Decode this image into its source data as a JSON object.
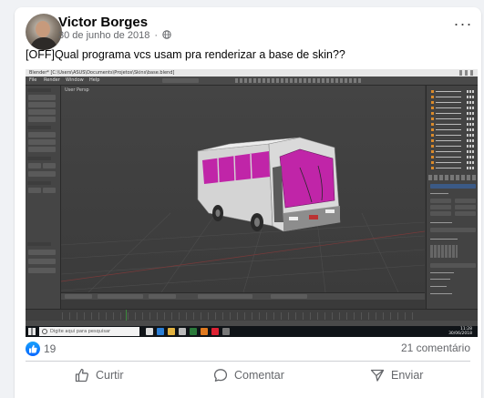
{
  "post": {
    "author": "Victor Borges",
    "date": "30 de junho de 2018",
    "separator": "·",
    "text": "[OFF]Qual programa vcs usam pra renderizar a base de skin??",
    "more_label": "···"
  },
  "screenshot": {
    "window_title": "Blender* [C:\\Users\\ASUS\\Documents\\Projetos\\Skins\\base.blend]",
    "menu": [
      "File",
      "Render",
      "Window",
      "Help"
    ],
    "viewport_label": "User Persp",
    "taskbar_search": "Digite aqui para pesquisar",
    "clock_time": "11:28",
    "clock_date": "30/06/2018",
    "colors": {
      "bus_pink": "#c025a8",
      "bus_body": "#d8d8d8",
      "accent_orange": "#d98a2b"
    }
  },
  "reactions": {
    "count": "19",
    "comments": "21 comentário"
  },
  "actions": {
    "like": "Curtir",
    "comment": "Comentar",
    "share": "Enviar"
  }
}
